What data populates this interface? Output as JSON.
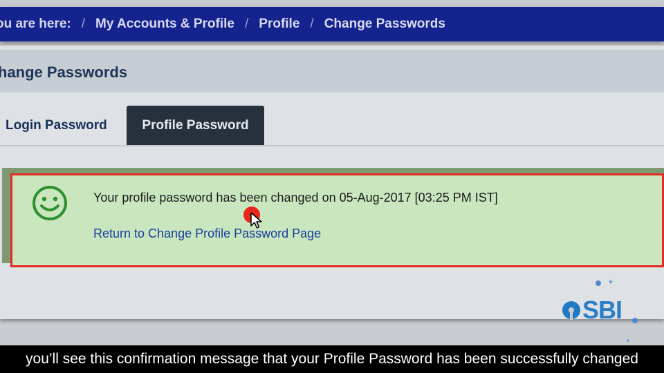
{
  "breadcrumb": {
    "prefix": "ou are here:",
    "separator": "/",
    "items": [
      "My Accounts & Profile",
      "Profile",
      "Change Passwords"
    ]
  },
  "page": {
    "title": "hange Passwords"
  },
  "tabs": [
    {
      "label": "Login Password",
      "active": false
    },
    {
      "label": "Profile Password",
      "active": true
    }
  ],
  "message": {
    "icon": "smiley-icon",
    "text": "Your profile password has been changed on 05-Aug-2017 [03:25 PM IST]",
    "link": "Return to Change Profile Password Page"
  },
  "logo": {
    "text": "SBI"
  },
  "subtitle": {
    "text": "you’ll see this confirmation message that your Profile Password has been successfully changed"
  },
  "colors": {
    "nav_bg": "#15238e",
    "active_tab_bg": "#27313d",
    "success_bg": "#c9e6bf",
    "highlight_border": "#e42b21",
    "link": "#173f9b",
    "smiley": "#2f8f2f"
  }
}
